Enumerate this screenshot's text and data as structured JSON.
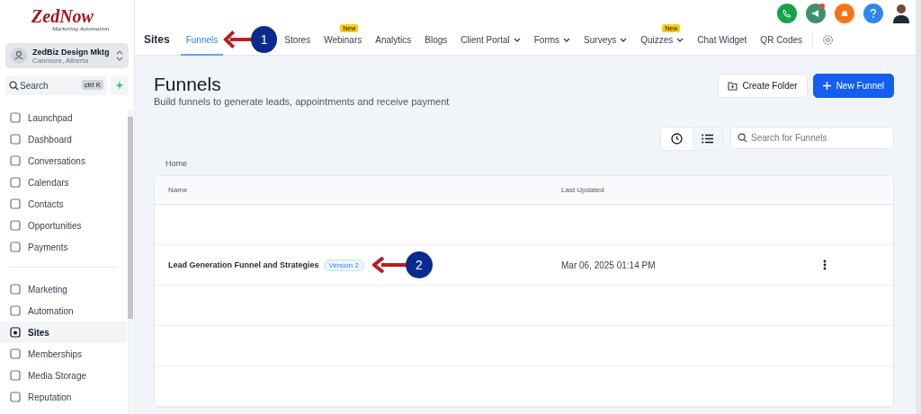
{
  "logo": {
    "name": "ZedNow",
    "tagline": "Marketing Automation"
  },
  "account": {
    "name": "ZedBiz Design Mktg",
    "location": "Canmore, Alberta"
  },
  "search": {
    "placeholder": "Search",
    "shortcut": "ctrl K"
  },
  "sidebar": {
    "groups": [
      [
        {
          "label": "Launchpad",
          "selected": false
        },
        {
          "label": "Dashboard",
          "selected": false
        },
        {
          "label": "Conversations",
          "selected": false
        },
        {
          "label": "Calendars",
          "selected": false
        },
        {
          "label": "Contacts",
          "selected": false
        },
        {
          "label": "Opportunities",
          "selected": false
        },
        {
          "label": "Payments",
          "selected": false
        }
      ],
      [
        {
          "label": "Marketing",
          "selected": false
        },
        {
          "label": "Automation",
          "selected": false
        },
        {
          "label": "Sites",
          "selected": true
        },
        {
          "label": "Memberships",
          "selected": false
        },
        {
          "label": "Media Storage",
          "selected": false
        },
        {
          "label": "Reputation",
          "selected": false
        }
      ]
    ]
  },
  "header": {
    "section": "Sites",
    "tabs": [
      {
        "label": "Funnels",
        "selected": true
      },
      {
        "label": "Stores",
        "selected": false
      },
      {
        "label": "Webinars",
        "selected": false,
        "badge": "New"
      },
      {
        "label": "Analytics",
        "selected": false
      },
      {
        "label": "Blogs",
        "selected": false
      },
      {
        "label": "Client Portal",
        "selected": false,
        "menu": true
      },
      {
        "label": "Forms",
        "selected": false,
        "menu": true
      },
      {
        "label": "Surveys",
        "selected": false,
        "menu": true
      },
      {
        "label": "Quizzes",
        "selected": false,
        "menu": true,
        "badge": "New"
      },
      {
        "label": "Chat Widget",
        "selected": false
      },
      {
        "label": "QR Codes",
        "selected": false
      }
    ]
  },
  "page": {
    "title": "Funnels",
    "subtitle": "Build funnels to generate leads, appointments and receive payment",
    "buttons": [
      {
        "kind": "secondary",
        "label": "Create Folder"
      },
      {
        "kind": "primary",
        "label": "New Funnel"
      }
    ],
    "view_toggle": [
      {
        "selected": false
      },
      {
        "selected": true
      }
    ],
    "search": {
      "placeholder": "Search for Funnels"
    },
    "breadcrumb": "Home"
  },
  "table": {
    "columns": [
      "Name",
      "Last Updated"
    ],
    "rows": [
      {
        "name": "Lead Generation Funnel and Strategies",
        "tag": "Version 2",
        "updated": "Mar 06, 2025 01:14 PM"
      }
    ]
  },
  "annotations": [
    {
      "number": "1"
    },
    {
      "number": "2"
    }
  ]
}
